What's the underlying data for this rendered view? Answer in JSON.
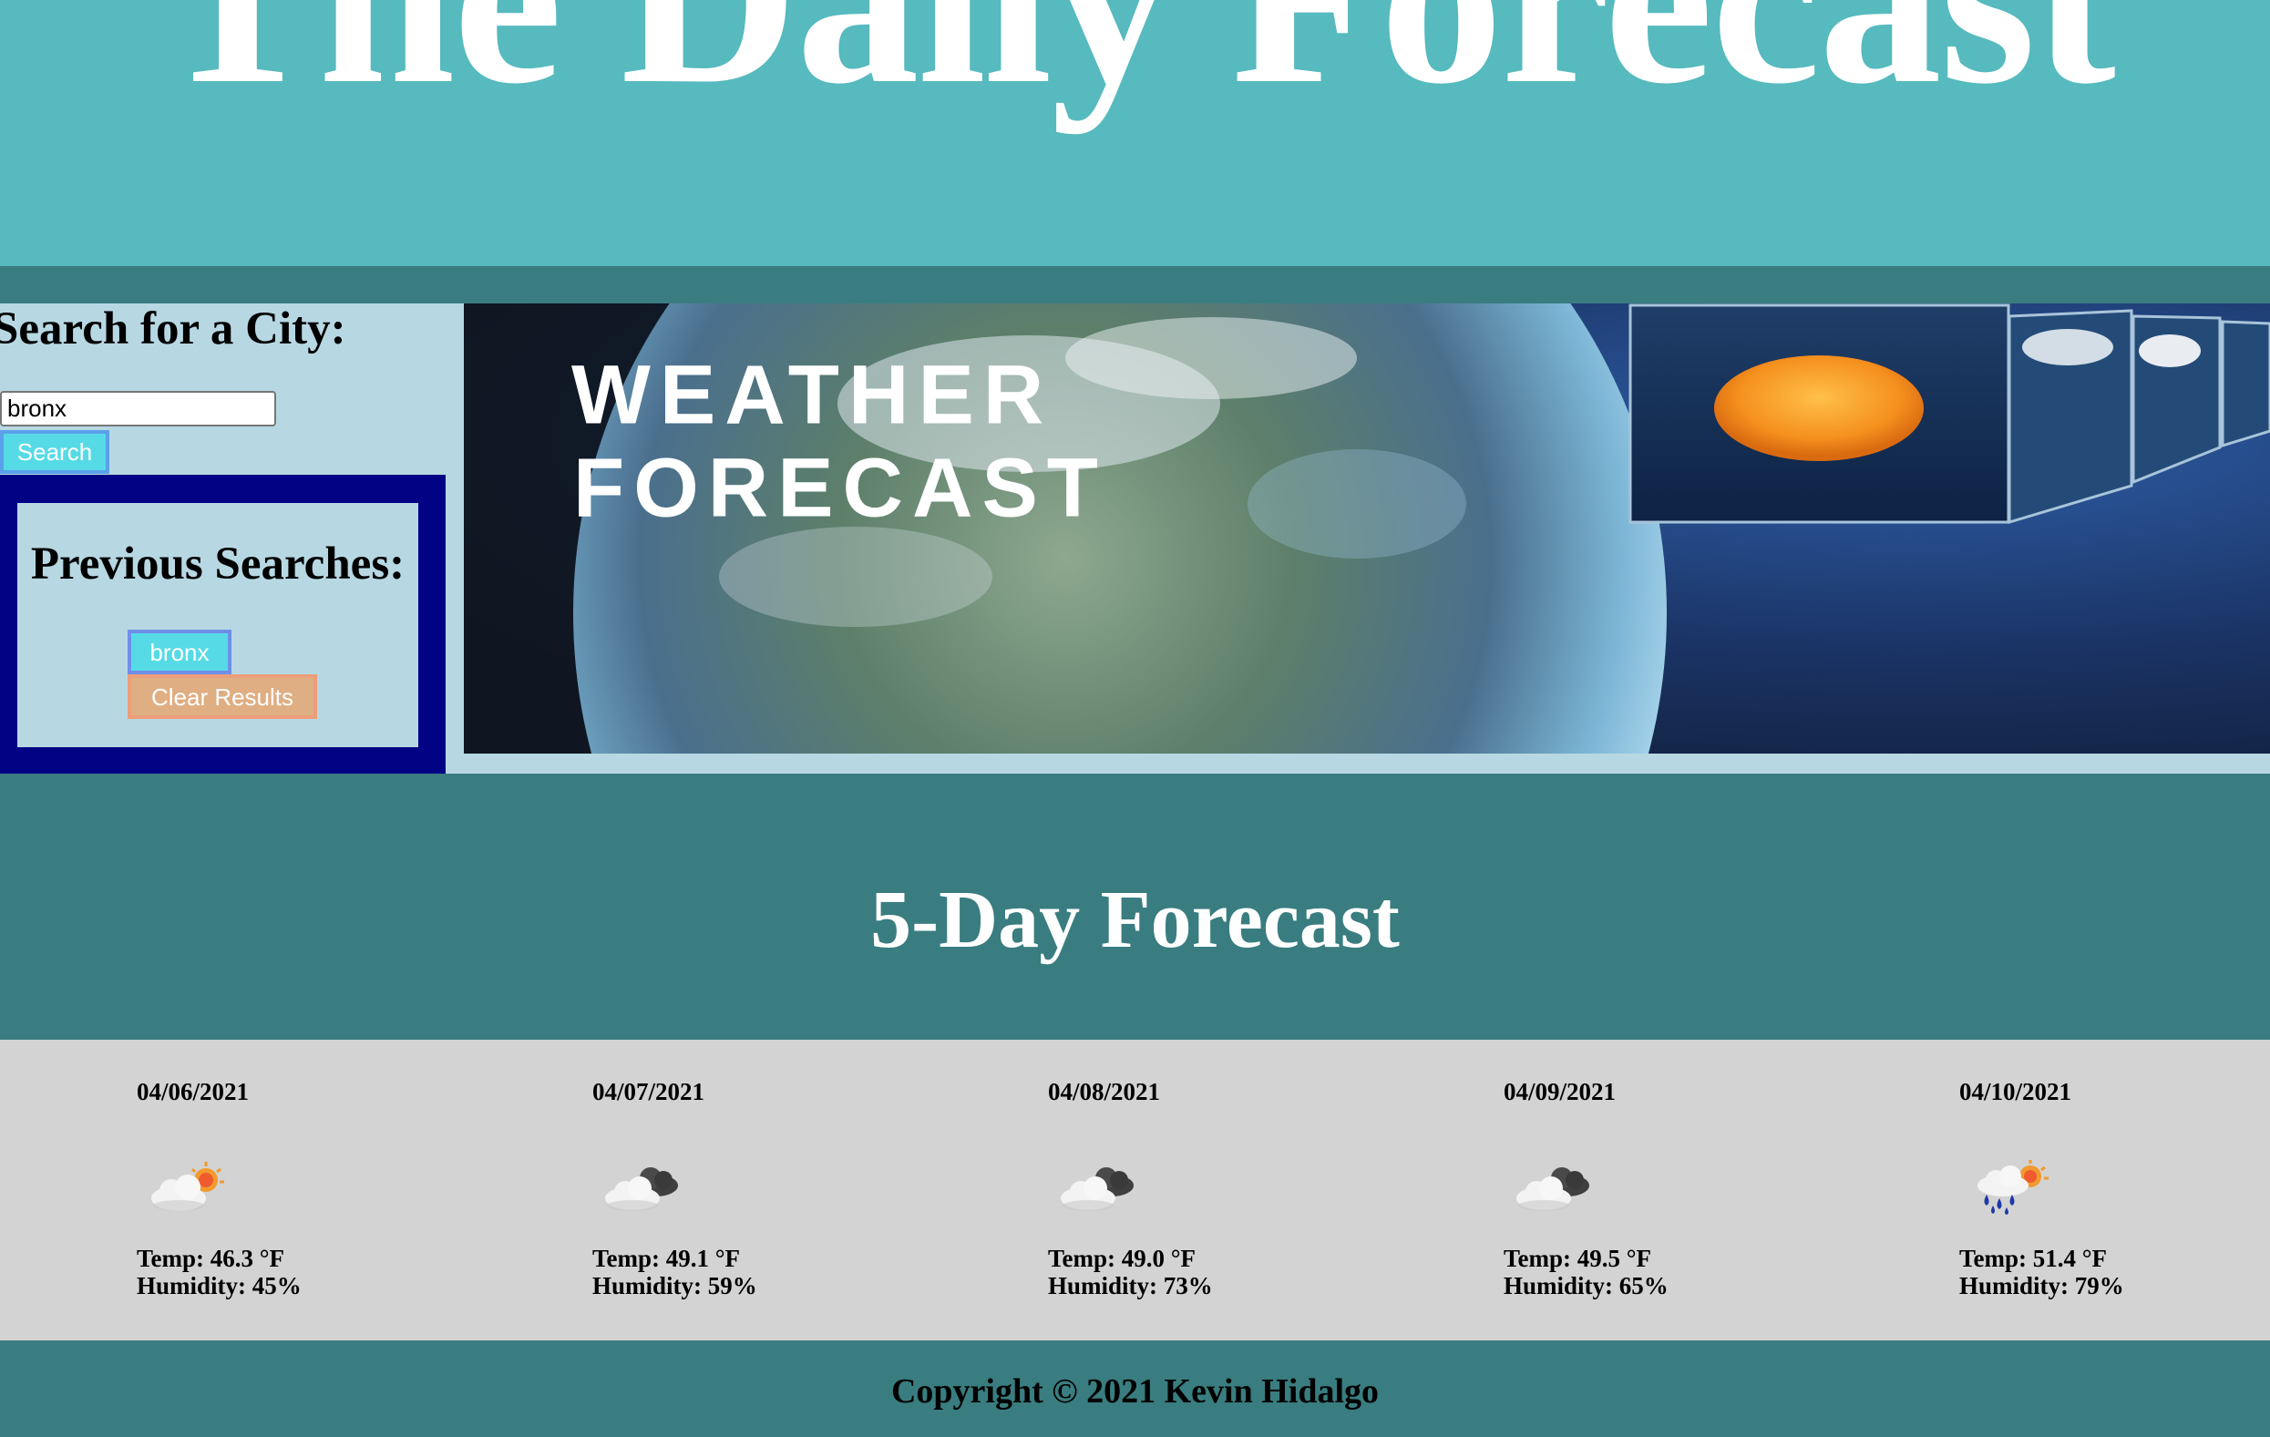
{
  "header": {
    "title": "The Daily Forecast"
  },
  "search": {
    "title": "Search for a City:",
    "input_value": "bronx",
    "button_label": "Search"
  },
  "history": {
    "title": "Previous Searches:",
    "items": [
      "bronx"
    ],
    "clear_label": "Clear Results"
  },
  "banner": {
    "line1": "WEATHER",
    "line2": "FORECAST"
  },
  "forecast": {
    "heading": "5-Day Forecast",
    "days": [
      {
        "date": "04/06/2021",
        "icon": "partly-sunny-cloud-icon",
        "temp": "Temp: 46.3 °F",
        "humidity": "Humidity: 45%"
      },
      {
        "date": "04/07/2021",
        "icon": "overcast-clouds-icon",
        "temp": "Temp: 49.1 °F",
        "humidity": "Humidity: 59%"
      },
      {
        "date": "04/08/2021",
        "icon": "overcast-clouds-icon",
        "temp": "Temp: 49.0 °F",
        "humidity": "Humidity: 73%"
      },
      {
        "date": "04/09/2021",
        "icon": "overcast-clouds-icon",
        "temp": "Temp: 49.5 °F",
        "humidity": "Humidity: 65%"
      },
      {
        "date": "04/10/2021",
        "icon": "rain-sun-cloud-icon",
        "temp": "Temp: 51.4 °F",
        "humidity": "Humidity: 79%"
      }
    ]
  },
  "footer": {
    "copyright": "Copyright © 2021 Kevin Hidalgo"
  },
  "colors": {
    "header_bg": "#56babe",
    "page_bg": "#397d80",
    "panel_bg": "#b7d8e3",
    "history_border": "#020285",
    "search_button": "#56dbe6",
    "clear_button": "#dfae82",
    "forecast_row_bg": "#d3d3d3"
  }
}
